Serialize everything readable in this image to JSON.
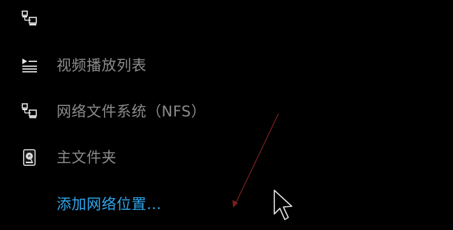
{
  "places": {
    "items": [
      {
        "id": "network",
        "label": "",
        "icon": "network-computer-icon"
      },
      {
        "id": "video-playlist",
        "label": "视频播放列表",
        "icon": "playlist-icon"
      },
      {
        "id": "nfs",
        "label": "网络文件系统（NFS）",
        "icon": "network-computer-icon"
      },
      {
        "id": "home",
        "label": "主文件夹",
        "icon": "hard-drive-icon"
      }
    ],
    "add_network_location": "添加网络位置…"
  },
  "colors": {
    "background": "#000000",
    "label": "#8c8c8c",
    "link": "#2fa7ee",
    "icon": "#e6e6e6",
    "annotation_arrow": "#7a1f1f"
  },
  "overlay": {
    "cursor": "mouse-pointer-icon",
    "annotation": "arrow-icon"
  }
}
